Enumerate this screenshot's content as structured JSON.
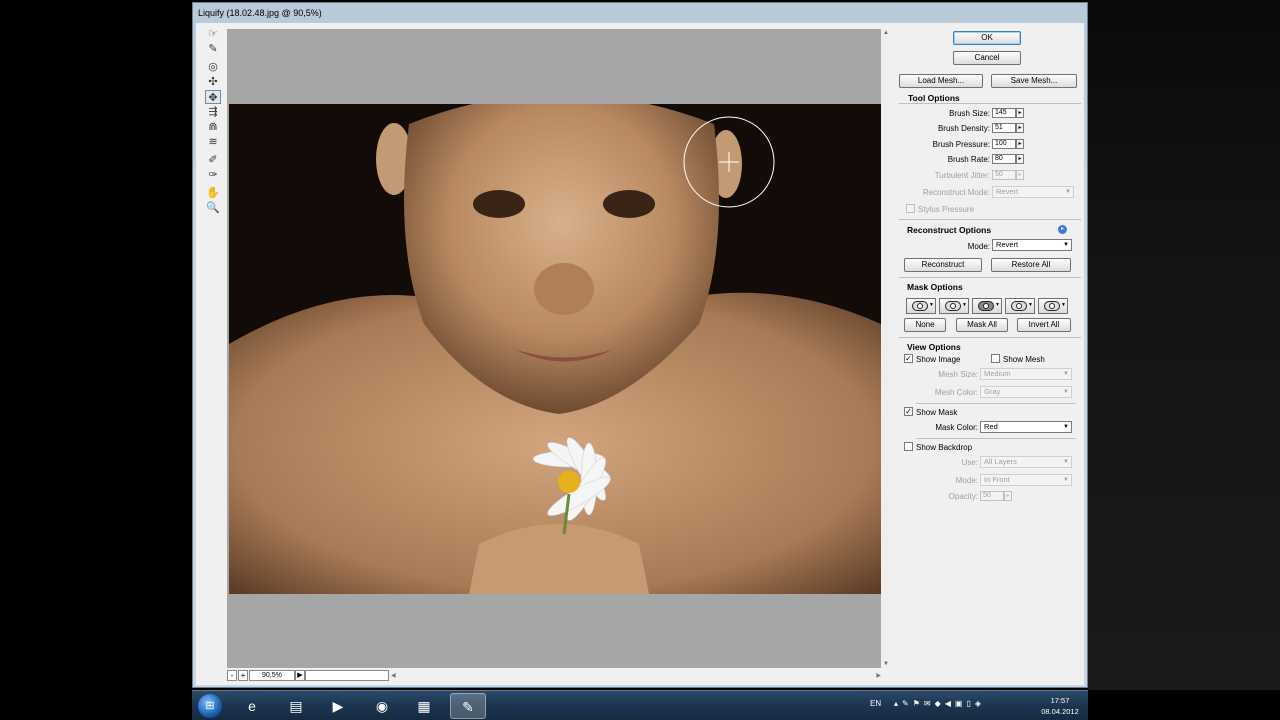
{
  "window": {
    "title": "Liquify (18.02.48.jpg @ 90,5%)"
  },
  "toolbox": {
    "tools": [
      {
        "name": "forward-warp-tool",
        "glyph": "☞"
      },
      {
        "name": "reconstruct-tool",
        "glyph": "✎"
      },
      {
        "name": "twirl-clockwise-tool",
        "glyph": "◎"
      },
      {
        "name": "pucker-tool",
        "glyph": "✣"
      },
      {
        "name": "bloat-tool",
        "glyph": "✥"
      },
      {
        "name": "push-left-tool",
        "glyph": "⇶"
      },
      {
        "name": "mirror-tool",
        "glyph": "⋒"
      },
      {
        "name": "turbulence-tool",
        "glyph": "≋"
      },
      {
        "name": "freeze-mask-tool",
        "glyph": "✐"
      },
      {
        "name": "thaw-mask-tool",
        "glyph": "✑"
      },
      {
        "name": "hand-tool",
        "glyph": "✋"
      },
      {
        "name": "zoom-tool",
        "glyph": "🔍"
      }
    ]
  },
  "status": {
    "zoom_minus": "-",
    "zoom_plus": "+",
    "zoom_value": "90,5%",
    "zoom_arrow": "▶"
  },
  "panel": {
    "ok": "OK",
    "cancel": "Cancel",
    "load_mesh": "Load Mesh...",
    "save_mesh": "Save Mesh...",
    "tool_options": {
      "title": "Tool Options",
      "brush_size_label": "Brush Size:",
      "brush_size": "145",
      "brush_density_label": "Brush Density:",
      "brush_density": "51",
      "brush_pressure_label": "Brush Pressure:",
      "brush_pressure": "100",
      "brush_rate_label": "Brush Rate:",
      "brush_rate": "80",
      "turbulent_jitter_label": "Turbulent Jitter:",
      "turbulent_jitter": "50",
      "reconstruct_mode_label": "Reconstruct Mode:",
      "reconstruct_mode": "Revert",
      "stylus_pressure": "Stylus Pressure"
    },
    "reconstruct_options": {
      "title": "Reconstruct Options",
      "mode_label": "Mode:",
      "mode": "Revert",
      "reconstruct_button": "Reconstruct",
      "restore_all_button": "Restore All"
    },
    "mask_options": {
      "title": "Mask Options",
      "none": "None",
      "mask_all": "Mask All",
      "invert_all": "Invert All"
    },
    "view_options": {
      "title": "View Options",
      "show_image": "Show Image",
      "show_mesh": "Show Mesh",
      "mesh_size_label": "Mesh Size:",
      "mesh_size": "Medium",
      "mesh_color_label": "Mesh Color:",
      "mesh_color": "Gray",
      "show_mask": "Show Mask",
      "mask_color_label": "Mask Color:",
      "mask_color": "Red",
      "show_backdrop": "Show Backdrop",
      "use_label": "Use:",
      "use": "All Layers",
      "mode_label": "Mode:",
      "mode": "In Front",
      "opacity_label": "Opacity:",
      "opacity": "50"
    }
  },
  "taskbar": {
    "apps": [
      {
        "name": "ie-icon",
        "glyph": "e"
      },
      {
        "name": "folder-icon",
        "glyph": "▤"
      },
      {
        "name": "media-player-icon",
        "glyph": "▶"
      },
      {
        "name": "chrome-icon",
        "glyph": "◉"
      },
      {
        "name": "notes-icon",
        "glyph": "▦"
      },
      {
        "name": "photoshop-icon",
        "glyph": "✎"
      }
    ],
    "language": "EN",
    "time": "17:57",
    "date": "08.04.2012"
  },
  "colors": {
    "accent": "#3c7fb1",
    "canvas_bg": "#a6a6a6",
    "brush_cursor": "#ffffff"
  }
}
